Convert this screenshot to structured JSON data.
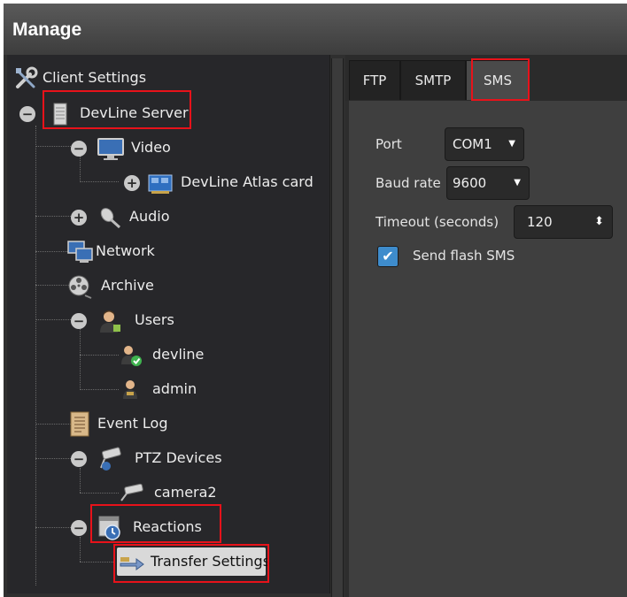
{
  "window": {
    "title": "Manage"
  },
  "tree": {
    "root": {
      "label": "Client Settings",
      "icon": "tools-icon"
    },
    "server": {
      "label": "DevLine Server",
      "icon": "server-icon"
    },
    "video": {
      "label": "Video",
      "icon": "monitor-icon"
    },
    "capture_card": {
      "label": "DevLine Atlas card",
      "icon": "capture-card-icon"
    },
    "audio": {
      "label": "Audio",
      "icon": "microphone-icon"
    },
    "network": {
      "label": "Network",
      "icon": "network-icon"
    },
    "archive": {
      "label": "Archive",
      "icon": "film-reel-icon"
    },
    "users": {
      "label": "Users",
      "icon": "users-icon"
    },
    "user_devline": {
      "label": "devline",
      "icon": "user-check-icon"
    },
    "user_admin": {
      "label": "admin",
      "icon": "user-icon"
    },
    "event_log": {
      "label": "Event Log",
      "icon": "document-icon"
    },
    "ptz": {
      "label": "PTZ Devices",
      "icon": "ptz-camera-icon"
    },
    "camera2": {
      "label": "camera2",
      "icon": "camera-icon"
    },
    "reactions": {
      "label": "Reactions",
      "icon": "reactions-icon"
    },
    "transfer": {
      "label": "Transfer Settings",
      "icon": "transfer-icon"
    }
  },
  "tabs": [
    {
      "label": "FTP"
    },
    {
      "label": "SMTP"
    },
    {
      "label": "SMS",
      "active": true
    }
  ],
  "sms": {
    "port_label": "Port",
    "port_value": "COM1",
    "baud_label": "Baud rate",
    "baud_value": "9600",
    "timeout_label": "Timeout (seconds)",
    "timeout_value": "120",
    "flash_label": "Send flash SMS",
    "flash_checked": true
  },
  "colors": {
    "highlight": "#e8121a",
    "checkbox": "#3e8ccc",
    "background": "#2f2f2f"
  }
}
